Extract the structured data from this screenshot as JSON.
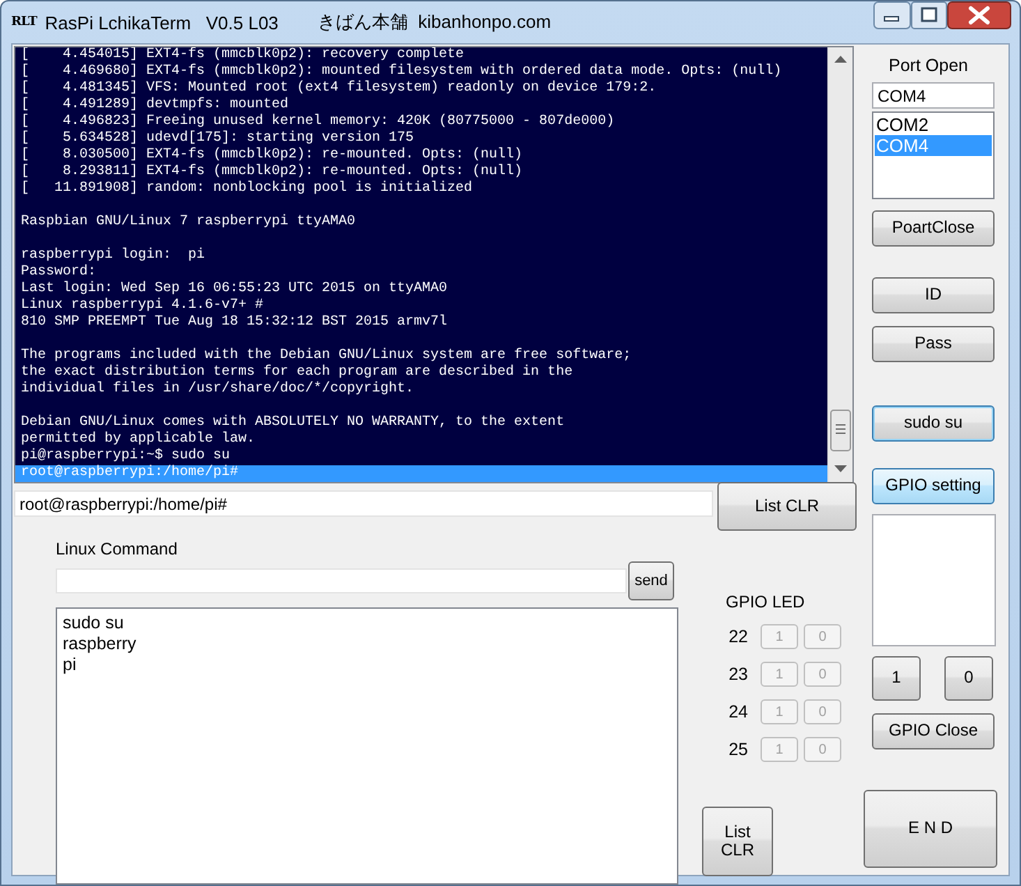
{
  "window": {
    "app_icon_text": "RLT",
    "title": "RasPi LchikaTerm   V0.5 L03",
    "subtitle": "きばん本舗  kibanhonpo.com"
  },
  "terminal": {
    "blocks": [
      [
        {
          "text": "[    4.454015] EXT4-fs (mmcblk0p2): recovery complete",
          "selected": false
        },
        {
          "text": "[    4.469680] EXT4-fs (mmcblk0p2): mounted filesystem with ordered data mode. Opts: (null)",
          "selected": false
        },
        {
          "text": "[    4.481345] VFS: Mounted root (ext4 filesystem) readonly on device 179:2.",
          "selected": false
        },
        {
          "text": "[    4.491289] devtmpfs: mounted",
          "selected": false
        },
        {
          "text": "[    4.496823] Freeing unused kernel memory: 420K (80775000 - 807de000)",
          "selected": false
        },
        {
          "text": "[    5.634528] udevd[175]: starting version 175",
          "selected": false
        },
        {
          "text": "[    8.030500] EXT4-fs (mmcblk0p2): re-mounted. Opts: (null)",
          "selected": false
        },
        {
          "text": "[    8.293811] EXT4-fs (mmcblk0p2): re-mounted. Opts: (null)",
          "selected": false
        },
        {
          "text": "[   11.891908] random: nonblocking pool is initialized",
          "selected": false
        }
      ],
      [
        {
          "text": "Raspbian GNU/Linux 7 raspberrypi ttyAMA0",
          "selected": false
        }
      ],
      [
        {
          "text": "raspberrypi login:  pi",
          "selected": false
        },
        {
          "text": "Password:",
          "selected": false
        },
        {
          "text": "Last login: Wed Sep 16 06:55:23 UTC 2015 on ttyAMA0",
          "selected": false
        },
        {
          "text": "Linux raspberrypi 4.1.6-v7+ #",
          "selected": false
        },
        {
          "text": "810 SMP PREEMPT Tue Aug 18 15:32:12 BST 2015 armv7l",
          "selected": false
        }
      ],
      [
        {
          "text": "The programs included with the Debian GNU/Linux system are free software;",
          "selected": false
        },
        {
          "text": "the exact distribution terms for each program are described in the",
          "selected": false
        },
        {
          "text": "individual files in /usr/share/doc/*/copyright.",
          "selected": false
        }
      ],
      [
        {
          "text": "Debian GNU/Linux comes with ABSOLUTELY NO WARRANTY, to the extent",
          "selected": false
        },
        {
          "text": "permitted by applicable law.",
          "selected": false
        },
        {
          "text": "pi@raspberrypi:~$ sudo su",
          "selected": false
        },
        {
          "text": "root@raspberrypi:/home/pi#",
          "selected": true
        }
      ]
    ]
  },
  "prompt_field": {
    "value": "root@raspberrypi:/home/pi#"
  },
  "list_clr_button": "List CLR",
  "command": {
    "label": "Linux Command",
    "send_button": "send"
  },
  "history": [
    "sudo su",
    "raspberry",
    "pi"
  ],
  "gpio_led": {
    "title": "GPIO LED",
    "rows": [
      {
        "pin": "22",
        "on_label": "1",
        "off_label": "0",
        "disabled": true
      },
      {
        "pin": "23",
        "on_label": "1",
        "off_label": "0",
        "disabled": true
      },
      {
        "pin": "24",
        "on_label": "1",
        "off_label": "0",
        "disabled": true
      },
      {
        "pin": "25",
        "on_label": "1",
        "off_label": "0",
        "disabled": true
      }
    ],
    "clear_button": "List\nCLR"
  },
  "port": {
    "label": "Port Open",
    "value": "COM4",
    "ports": [
      {
        "name": "COM2",
        "selected": false
      },
      {
        "name": "COM4",
        "selected": true
      }
    ]
  },
  "side_buttons": [
    {
      "label": "PoartClose",
      "focused": false,
      "highlighted": false
    },
    {
      "label": "ID",
      "focused": false,
      "highlighted": false
    },
    {
      "label": "Pass",
      "focused": false,
      "highlighted": false
    },
    {
      "label": "sudo su",
      "focused": true,
      "highlighted": false
    },
    {
      "label": "GPIO setting",
      "focused": false,
      "highlighted": true
    }
  ],
  "gpio_buttons": {
    "on": "1",
    "off": "0",
    "close": "GPIO Close"
  },
  "end_button": "E N D"
}
